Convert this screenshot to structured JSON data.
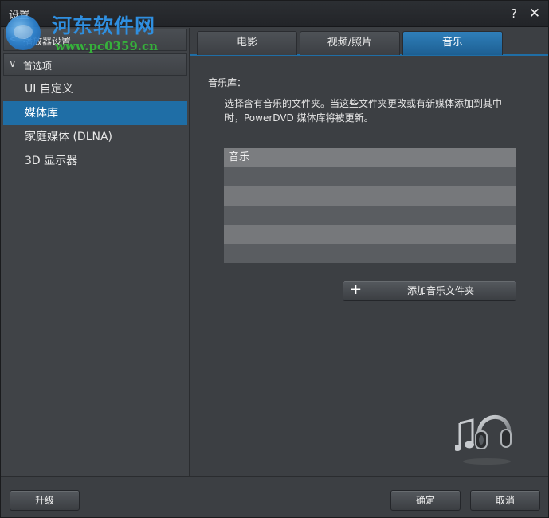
{
  "window": {
    "title": "设置",
    "help_label": "?",
    "close_label": "✕"
  },
  "watermark": {
    "title": "河东软件网",
    "url": "www.pc0359.cn"
  },
  "sidebar": {
    "group_player": {
      "label": "播放器设置",
      "chevron": "<"
    },
    "group_prefs": {
      "label": "首选项",
      "chevron": "∨"
    },
    "items": [
      {
        "label": "UI 自定义",
        "selected": false
      },
      {
        "label": "媒体库",
        "selected": true
      },
      {
        "label": "家庭媒体 (DLNA)",
        "selected": false
      },
      {
        "label": "3D 显示器",
        "selected": false
      }
    ]
  },
  "tabs": [
    {
      "label": "电影",
      "active": false
    },
    {
      "label": "视频/照片",
      "active": false
    },
    {
      "label": "音乐",
      "active": true
    }
  ],
  "main": {
    "section_label": "音乐库：",
    "description": "选择含有音乐的文件夹。当这些文件夹更改或有新媒体添加到其中时，PowerDVD 媒体库将被更新。",
    "folder_list": {
      "header": "音乐",
      "rows": [
        "",
        "",
        "",
        "",
        ""
      ]
    },
    "add_folder_button": {
      "icon": "+",
      "label": "添加音乐文件夹"
    }
  },
  "footer": {
    "upgrade_label": "升级",
    "ok_label": "确定",
    "cancel_label": "取消"
  },
  "colors": {
    "accent": "#1f6ea6",
    "background": "#3c3f43",
    "sidebar": "#404347"
  },
  "icons": {
    "music_decoration": "headphones-music-icon"
  }
}
